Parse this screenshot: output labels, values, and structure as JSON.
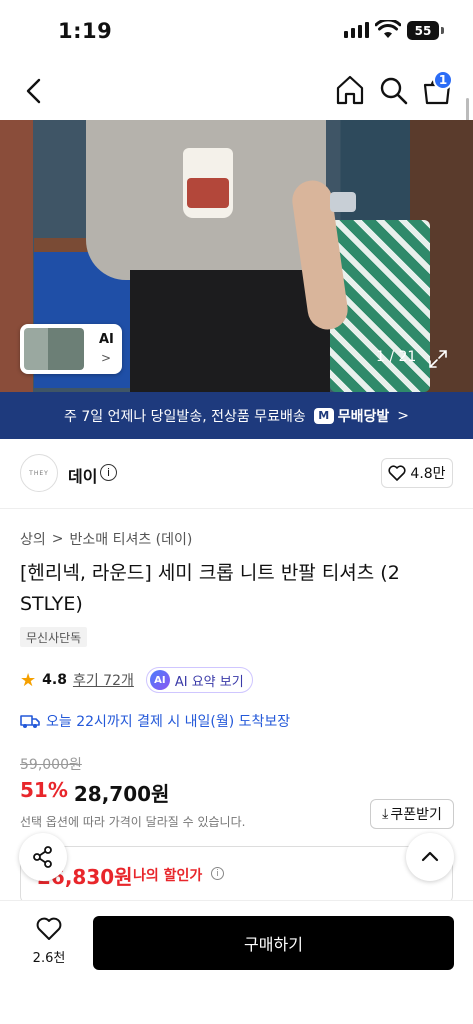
{
  "status_bar": {
    "time": "1:19",
    "battery": "55"
  },
  "nav": {
    "cart_count": "1"
  },
  "hero": {
    "thumb_label": "AI",
    "counter": "1 / 21"
  },
  "banner": {
    "text": "주 7일 언제나 당일발송, 전상품 무료배송",
    "badge_icon": "M",
    "badge_label": "무배당발"
  },
  "brand": {
    "logo_text": "THEY",
    "name": "데이",
    "likes": "4.8만"
  },
  "breadcrumb": {
    "level1": "상의",
    "level2": "반소매 티셔츠 (데이)"
  },
  "product": {
    "title": "[헨리넥, 라운드] 세미 크롭 니트 반팔 티셔츠 (2 STLYE)",
    "exclusive_tag": "무신사단독"
  },
  "review": {
    "rating": "4.8",
    "count": "후기 72개",
    "ai_icon": "AI",
    "ai_label": "AI 요약 보기"
  },
  "shipping": {
    "text": "오늘 22시까지 결제 시 내일(월) 도착보장"
  },
  "pricing": {
    "original": "59,000원",
    "discount": "51%",
    "sale": "28,700원",
    "note": "선택 옵션에 따라 가격이 달라질 수 있습니다.",
    "coupon_label": "쿠폰받기",
    "my_price": "26,830원",
    "my_price_label": "나의 할인가"
  },
  "bottom_bar": {
    "wish_count": "2.6천",
    "buy_label": "구매하기"
  }
}
